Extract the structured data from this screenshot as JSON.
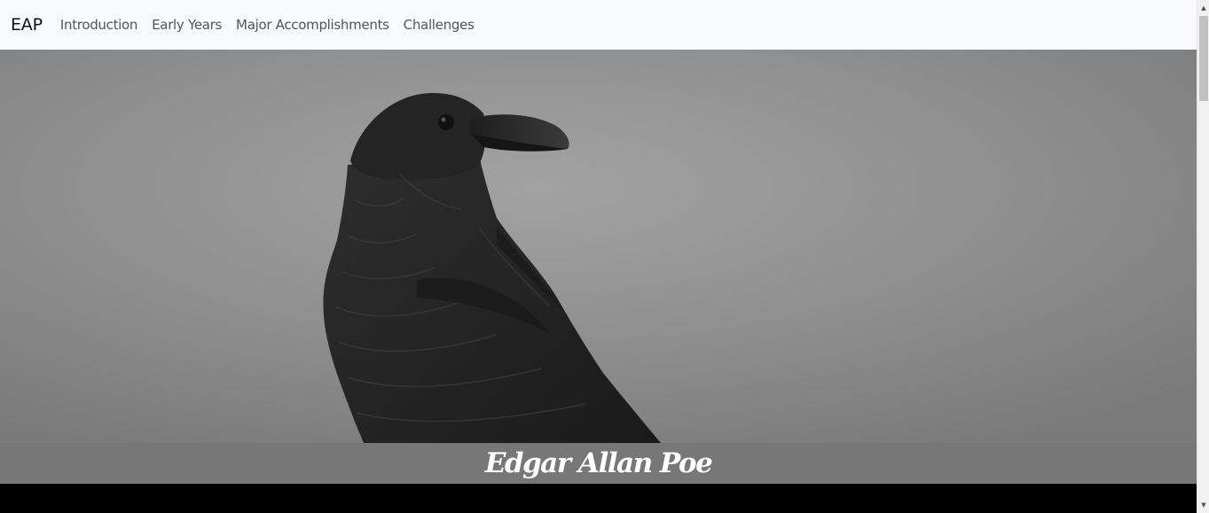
{
  "navbar": {
    "brand": "EAP",
    "links": [
      {
        "label": "Introduction"
      },
      {
        "label": "Early Years"
      },
      {
        "label": "Major Accomplishments"
      },
      {
        "label": "Challenges"
      }
    ]
  },
  "hero": {
    "image_icon": "raven-photo",
    "title": "Edgar Allan Poe"
  },
  "scrollbar": {
    "up_icon": "scroll-up-arrow-icon",
    "down_icon": "scroll-down-arrow-icon"
  }
}
